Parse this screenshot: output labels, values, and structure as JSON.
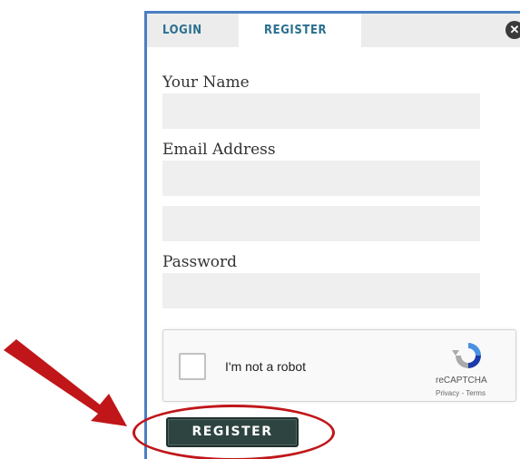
{
  "tabs": {
    "login_label": "LOGIN",
    "register_label": "REGISTER"
  },
  "form": {
    "name_label": "Your Name",
    "email_label": "Email Address",
    "password_label": "Password"
  },
  "recaptcha": {
    "checkbox_label": "I'm not a robot",
    "brand": "reCAPTCHA",
    "links": "Privacy - Terms"
  },
  "submit": {
    "label": "REGISTER"
  },
  "icons": {
    "close": "close-icon",
    "recaptcha_logo": "recaptcha-logo-icon",
    "annotation_arrow": "arrow-icon"
  },
  "colors": {
    "panel_border": "#4a7fc1",
    "tab_text": "#2a6f8e",
    "button_bg": "#2e4440",
    "annotation": "#c0161a"
  }
}
